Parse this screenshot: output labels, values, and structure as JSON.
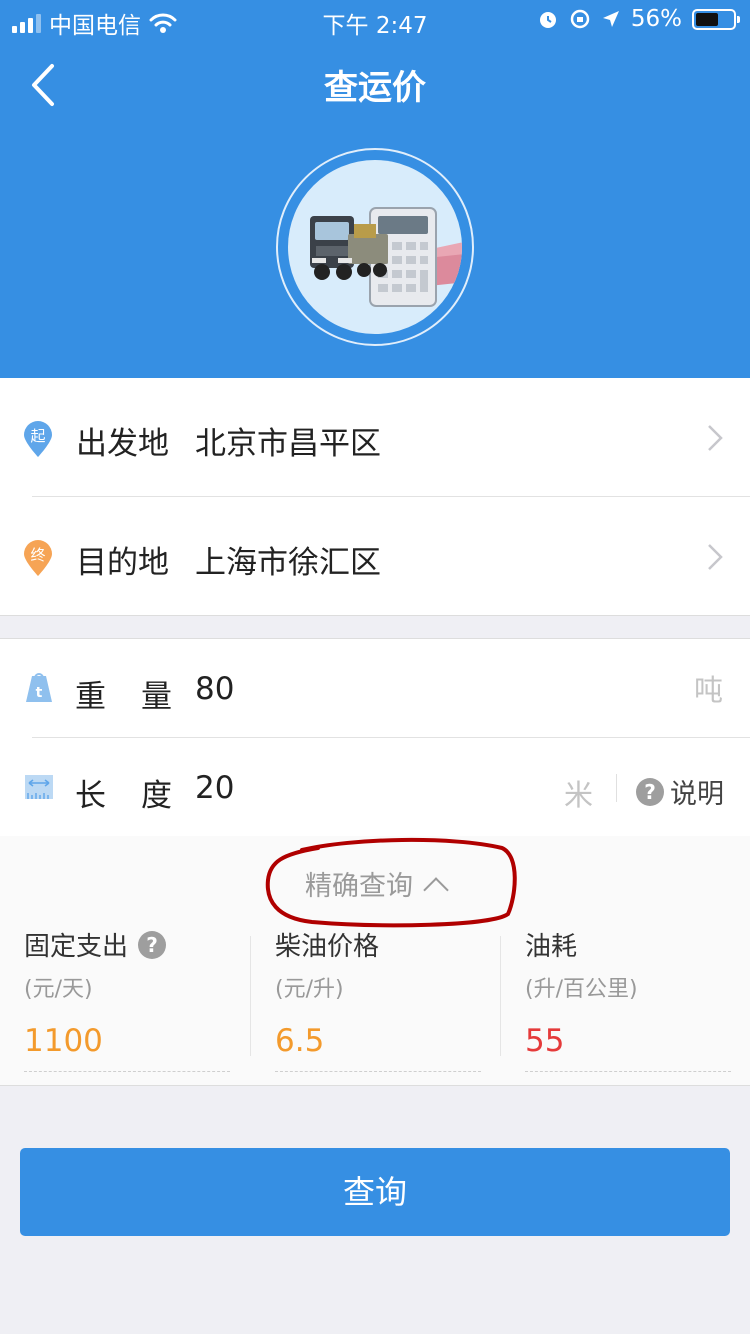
{
  "status_bar": {
    "carrier": "中国电信",
    "time": "下午 2:47",
    "battery": "56%"
  },
  "header": {
    "title": "查运价",
    "back_icon": "chevron-left-icon",
    "logo": "truck-calculator-logo"
  },
  "route": {
    "origin": {
      "badge": "起",
      "label": "出发地",
      "value": "北京市昌平区"
    },
    "destination": {
      "badge": "终",
      "label": "目的地",
      "value": "上海市徐汇区"
    }
  },
  "cargo": {
    "weight": {
      "label_a": "重",
      "label_b": "量",
      "value": "80",
      "unit": "吨"
    },
    "length": {
      "label_a": "长",
      "label_b": "度",
      "value": "20",
      "unit": "米",
      "help_label": "说明"
    }
  },
  "precise": {
    "toggle_label": "精确查询",
    "params": [
      {
        "name": "固定支出",
        "unit": "(元/天)",
        "value": "1100",
        "color": "#f39a2c"
      },
      {
        "name": "柴油价格",
        "unit": "(元/升)",
        "value": "6.5",
        "color": "#f39a2c"
      },
      {
        "name": "油耗",
        "unit": "(升/百公里)",
        "value": "55",
        "color": "#e53a3a"
      }
    ]
  },
  "submit_label": "查询",
  "colors": {
    "primary": "#368fe3",
    "annotation": "#c00000"
  }
}
